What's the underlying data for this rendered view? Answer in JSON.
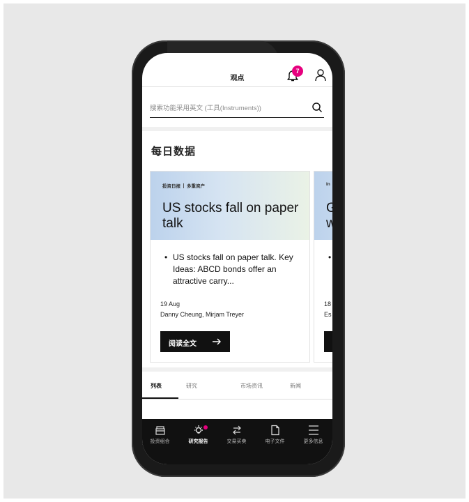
{
  "header": {
    "title": "观点",
    "notification_count": "7"
  },
  "search": {
    "placeholder": "搜索功能采用英文 (工具(Instruments))"
  },
  "section": {
    "title": "每日数据"
  },
  "cards": [
    {
      "tag_primary": "投资日报",
      "tag_secondary": "多重资产",
      "title": "US stocks fall on paper talk",
      "bullet": "US stocks fall on paper talk. Key Ideas: ABCD bonds offer an attractive carry...",
      "date": "19 Aug",
      "authors": "Danny Cheung, Mirjam Treyer",
      "button_label": "阅读全文"
    },
    {
      "tag_primary": "In",
      "title": "G w",
      "date": "18",
      "authors": "Es"
    }
  ],
  "tabs": [
    {
      "label": "列表",
      "active": true
    },
    {
      "label": "研究",
      "active": false
    },
    {
      "label": "市场资讯",
      "active": false
    },
    {
      "label": "新闻",
      "active": false
    }
  ],
  "bottom_nav": [
    {
      "label": "投资组合",
      "icon": "portfolio-icon",
      "active": false
    },
    {
      "label": "研究报告",
      "icon": "lightbulb-icon",
      "active": true,
      "has_dot": true
    },
    {
      "label": "交易买卖",
      "icon": "swap-arrows-icon",
      "active": false
    },
    {
      "label": "电子文件",
      "icon": "document-icon",
      "active": false
    },
    {
      "label": "更多信息",
      "icon": "menu-icon",
      "active": false
    }
  ],
  "colors": {
    "accent": "#e6007e",
    "dark": "#111111",
    "backdrop": "#e8e8e8"
  }
}
